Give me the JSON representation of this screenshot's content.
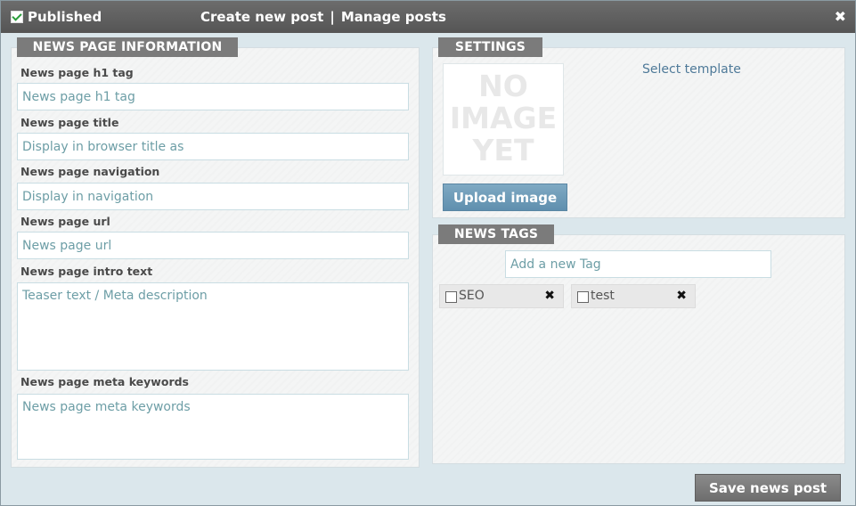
{
  "header": {
    "published_label": "Published",
    "nav_create": "Create new post",
    "nav_separator": "|",
    "nav_manage": "Manage posts",
    "close_glyph": "✖"
  },
  "news_info": {
    "title": "NEWS PAGE INFORMATION",
    "fields": [
      {
        "label": "News page h1 tag",
        "placeholder": "News page h1 tag"
      },
      {
        "label": "News page title",
        "placeholder": "Display in browser title as"
      },
      {
        "label": "News page navigation",
        "placeholder": "Display in navigation"
      },
      {
        "label": "News page url",
        "placeholder": "News page url"
      },
      {
        "label": "News page intro text",
        "placeholder": "Teaser text / Meta description"
      },
      {
        "label": "News page meta keywords",
        "placeholder": "News page meta keywords"
      }
    ]
  },
  "settings": {
    "title": "SETTINGS",
    "no_image_line1": "NO",
    "no_image_line2": "IMAGE",
    "no_image_line3": "YET",
    "upload_label": "Upload image",
    "select_template_label": "Select template"
  },
  "news_tags": {
    "title": "NEWS TAGS",
    "add_placeholder": "Add a new Tag",
    "tags": [
      {
        "label": "SEO",
        "remove_glyph": "✖"
      },
      {
        "label": "test",
        "remove_glyph": "✖"
      }
    ]
  },
  "footer": {
    "save_label": "Save news post"
  },
  "colors": {
    "title_bar": "#5f5f5f",
    "tab_label": "#7b7b7b",
    "upload_button": "#6b98b6",
    "save_button": "#7a7a7a",
    "placeholder_text": "#6d9ea6"
  }
}
